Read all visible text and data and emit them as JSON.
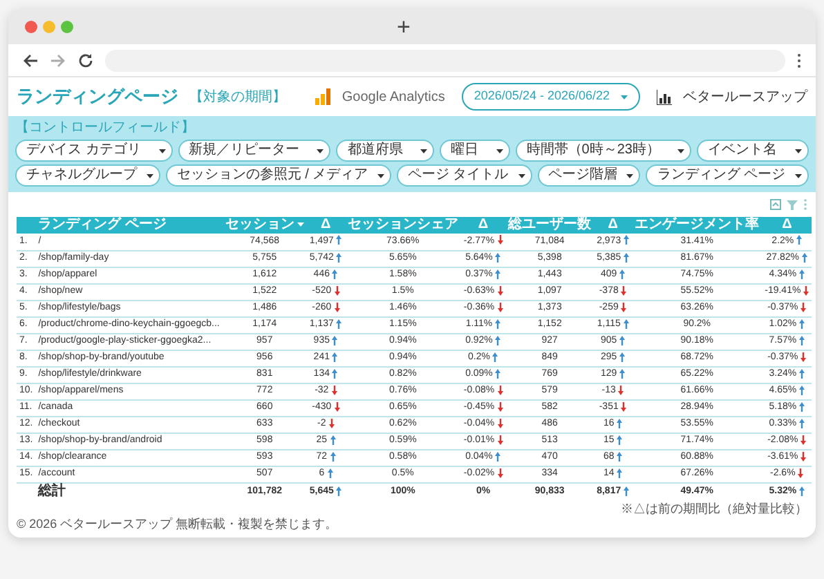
{
  "browser": {
    "new_tab": "+"
  },
  "header": {
    "title": "ランディングページ",
    "period_label": "【対象の期間】",
    "analytics_label": "Google Analytics",
    "date_range": "2026/05/24 - 2026/06/22",
    "brand": "ベタールースアップ"
  },
  "control_field": {
    "label": "【コントロールフィールド】",
    "filter_rows": [
      {
        "filters": [
          {
            "label": "デバイス カテゴリ"
          },
          {
            "label": "新規／リピーター"
          },
          {
            "label": "都道府県"
          },
          {
            "label": "曜日"
          },
          {
            "label": "時間帯（0時～23時）"
          },
          {
            "label": "イベント名"
          }
        ]
      },
      {
        "filters": [
          {
            "label": "チャネルグループ"
          },
          {
            "label": "セッションの参照元 / メディア"
          },
          {
            "label": "ページ タイトル"
          },
          {
            "label": "ページ階層"
          },
          {
            "label": "ランディング ページ"
          }
        ]
      }
    ]
  },
  "table": {
    "columns": [
      {
        "label": "ランディング ページ",
        "sorted": false
      },
      {
        "label": "セッション",
        "sorted": true
      },
      {
        "label": "Δ",
        "sorted": false
      },
      {
        "label": "セッションシェア",
        "sorted": false
      },
      {
        "label": "Δ",
        "sorted": false
      },
      {
        "label": "総ユーザー数",
        "sorted": false
      },
      {
        "label": "Δ",
        "sorted": false
      },
      {
        "label": "エンゲージメント率",
        "sorted": false
      },
      {
        "label": "Δ",
        "sorted": false
      }
    ],
    "rows": [
      {
        "index": "1.",
        "cells": [
          "/",
          "74,568",
          {
            "value": "1,497",
            "rising": true
          },
          "73.66%",
          {
            "value": "-2.77%",
            "rising": false
          },
          "71,084",
          {
            "value": "2,973",
            "rising": true
          },
          "31.41%",
          {
            "value": "2.2%",
            "rising": true
          }
        ]
      },
      {
        "index": "2.",
        "cells": [
          "/shop/family-day",
          "5,755",
          {
            "value": "5,742",
            "rising": true
          },
          "5.65%",
          {
            "value": "5.64%",
            "rising": true
          },
          "5,398",
          {
            "value": "5,385",
            "rising": true
          },
          "81.67%",
          {
            "value": "27.82%",
            "rising": true
          }
        ]
      },
      {
        "index": "3.",
        "cells": [
          "/shop/apparel",
          "1,612",
          {
            "value": "446",
            "rising": true
          },
          "1.58%",
          {
            "value": "0.37%",
            "rising": true
          },
          "1,443",
          {
            "value": "409",
            "rising": true
          },
          "74.75%",
          {
            "value": "4.34%",
            "rising": true
          }
        ]
      },
      {
        "index": "4.",
        "cells": [
          "/shop/new",
          "1,522",
          {
            "value": "-520",
            "rising": false
          },
          "1.5%",
          {
            "value": "-0.63%",
            "rising": false
          },
          "1,097",
          {
            "value": "-378",
            "rising": false
          },
          "55.52%",
          {
            "value": "-19.41%",
            "rising": false
          }
        ]
      },
      {
        "index": "5.",
        "cells": [
          "/shop/lifestyle/bags",
          "1,486",
          {
            "value": "-260",
            "rising": false
          },
          "1.46%",
          {
            "value": "-0.36%",
            "rising": false
          },
          "1,373",
          {
            "value": "-259",
            "rising": false
          },
          "63.26%",
          {
            "value": "-0.37%",
            "rising": false
          }
        ]
      },
      {
        "index": "6.",
        "cells": [
          "/product/chrome-dino-keychain-ggoegcb...",
          "1,174",
          {
            "value": "1,137",
            "rising": true
          },
          "1.15%",
          {
            "value": "1.11%",
            "rising": true
          },
          "1,152",
          {
            "value": "1,115",
            "rising": true
          },
          "90.2%",
          {
            "value": "1.02%",
            "rising": true
          }
        ]
      },
      {
        "index": "7.",
        "cells": [
          "/product/google-play-sticker-ggoegka2...",
          "957",
          {
            "value": "935",
            "rising": true
          },
          "0.94%",
          {
            "value": "0.92%",
            "rising": true
          },
          "927",
          {
            "value": "905",
            "rising": true
          },
          "90.18%",
          {
            "value": "7.57%",
            "rising": true
          }
        ]
      },
      {
        "index": "8.",
        "cells": [
          "/shop/shop-by-brand/youtube",
          "956",
          {
            "value": "241",
            "rising": true
          },
          "0.94%",
          {
            "value": "0.2%",
            "rising": true
          },
          "849",
          {
            "value": "295",
            "rising": true
          },
          "68.72%",
          {
            "value": "-0.37%",
            "rising": false
          }
        ]
      },
      {
        "index": "9.",
        "cells": [
          "/shop/lifestyle/drinkware",
          "831",
          {
            "value": "134",
            "rising": true
          },
          "0.82%",
          {
            "value": "0.09%",
            "rising": true
          },
          "769",
          {
            "value": "129",
            "rising": true
          },
          "65.22%",
          {
            "value": "3.24%",
            "rising": true
          }
        ]
      },
      {
        "index": "10.",
        "cells": [
          "/shop/apparel/mens",
          "772",
          {
            "value": "-32",
            "rising": false
          },
          "0.76%",
          {
            "value": "-0.08%",
            "rising": false
          },
          "579",
          {
            "value": "-13",
            "rising": false
          },
          "61.66%",
          {
            "value": "4.65%",
            "rising": true
          }
        ]
      },
      {
        "index": "11.",
        "cells": [
          "/canada",
          "660",
          {
            "value": "-430",
            "rising": false
          },
          "0.65%",
          {
            "value": "-0.45%",
            "rising": false
          },
          "582",
          {
            "value": "-351",
            "rising": false
          },
          "28.94%",
          {
            "value": "5.18%",
            "rising": true
          }
        ]
      },
      {
        "index": "12.",
        "cells": [
          "/checkout",
          "633",
          {
            "value": "-2",
            "rising": false
          },
          "0.62%",
          {
            "value": "-0.04%",
            "rising": false
          },
          "486",
          {
            "value": "16",
            "rising": true
          },
          "53.55%",
          {
            "value": "0.33%",
            "rising": true
          }
        ]
      },
      {
        "index": "13.",
        "cells": [
          "/shop/shop-by-brand/android",
          "598",
          {
            "value": "25",
            "rising": true
          },
          "0.59%",
          {
            "value": "-0.01%",
            "rising": false
          },
          "513",
          {
            "value": "15",
            "rising": true
          },
          "71.74%",
          {
            "value": "-2.08%",
            "rising": false
          }
        ]
      },
      {
        "index": "14.",
        "cells": [
          "/shop/clearance",
          "593",
          {
            "value": "72",
            "rising": true
          },
          "0.58%",
          {
            "value": "0.04%",
            "rising": true
          },
          "470",
          {
            "value": "68",
            "rising": true
          },
          "60.88%",
          {
            "value": "-3.61%",
            "rising": false
          }
        ]
      },
      {
        "index": "15.",
        "cells": [
          "/account",
          "507",
          {
            "value": "6",
            "rising": true
          },
          "0.5%",
          {
            "value": "-0.02%",
            "rising": false
          },
          "334",
          {
            "value": "14",
            "rising": true
          },
          "67.26%",
          {
            "value": "-2.6%",
            "rising": false
          }
        ]
      }
    ],
    "total": {
      "cells": [
        "総計",
        "101,782",
        {
          "value": "5,645",
          "rising": true
        },
        "100%",
        {
          "value": "0%"
        },
        "90,833",
        {
          "value": "8,817",
          "rising": true
        },
        "49.47%",
        {
          "value": "5.32%",
          "rising": true
        }
      ]
    }
  },
  "note": "※△は前の期間比（絶対量比較）",
  "footer": "© 2026 ベタールースアップ 無断転載・複製を禁じます。"
}
